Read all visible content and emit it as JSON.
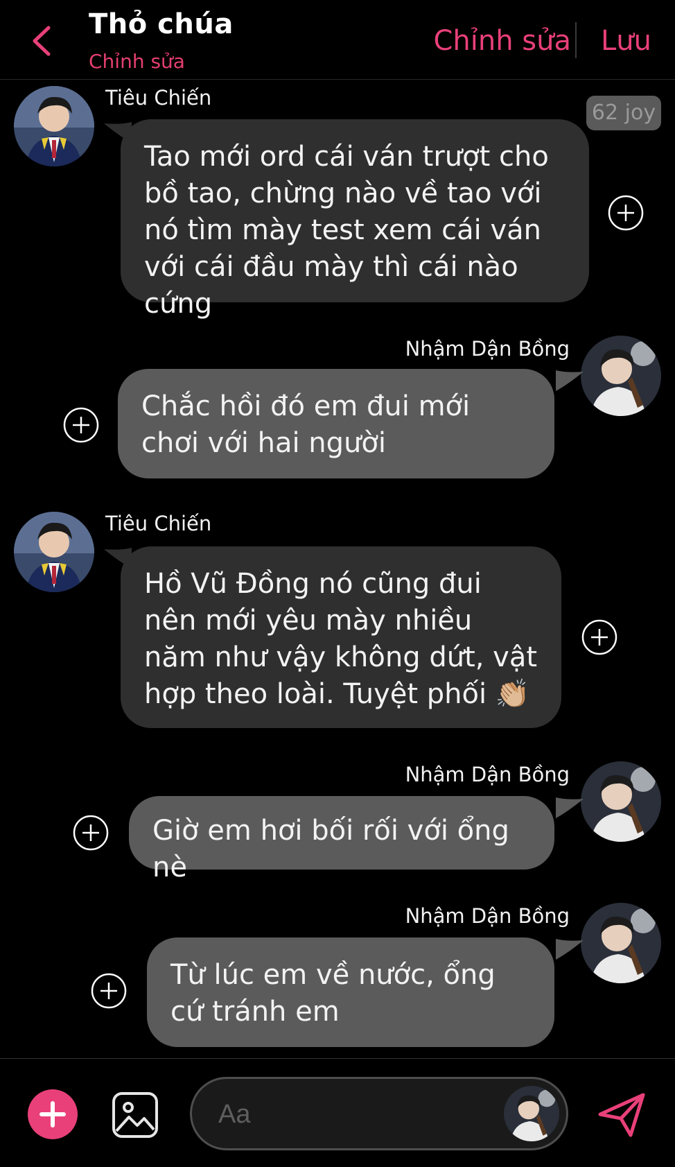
{
  "header": {
    "title": "Thỏ chúa",
    "subtitle": "Chỉnh sửa",
    "edit_label": "Chỉnh sửa",
    "save_label": "Lưu"
  },
  "accent_color": "#e9407a",
  "joy_badge": "62 joy",
  "messages": [
    {
      "side": "left",
      "sender": "Tiêu Chiến",
      "text": "Tao mới ord cái ván trượt cho bồ tao, chừng nào về tao với nó tìm mày test xem cái ván với cái đầu mày thì cái nào cứng"
    },
    {
      "side": "right",
      "sender": "Nhậm Dận Bồng",
      "text": "Chắc hồi đó em đui mới chơi với hai người"
    },
    {
      "side": "left",
      "sender": "Tiêu Chiến",
      "text": "Hồ Vũ Đồng nó cũng đui nên mới yêu mày nhiều năm như vậy không dứt, vật hợp theo loài. Tuyệt phối 👏🏼"
    },
    {
      "side": "right",
      "sender": "Nhậm Dận Bồng",
      "text": "Giờ em hơi bối rối với ổng nè"
    },
    {
      "side": "right",
      "sender": "Nhậm Dận Bồng",
      "text": "Từ lúc em về nước, ổng cứ tránh em"
    }
  ],
  "composer": {
    "placeholder": "Aa"
  }
}
